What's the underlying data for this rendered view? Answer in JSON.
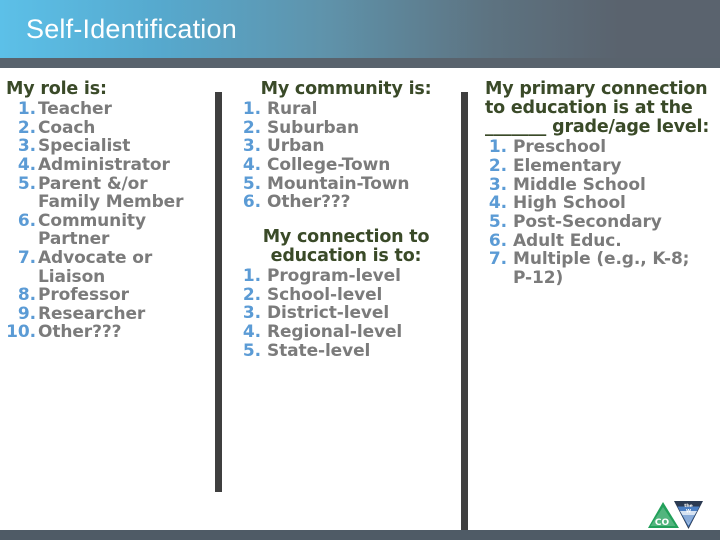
{
  "header": {
    "title": "Self-Identification",
    "gradient_start": "#5cc0e8",
    "gradient_end": "#5a636e",
    "title_color": "#ffffff"
  },
  "theme": {
    "heading_color": "#3a4a28",
    "number_color": "#5b9bd5",
    "item_color": "#7b7b7b",
    "divider_color": "#3f3f3f",
    "footer_color": "#4f5b66"
  },
  "columns": {
    "role": {
      "heading": "My role is:",
      "items": [
        {
          "num": "1.",
          "label": "Teacher"
        },
        {
          "num": "2.",
          "label": "Coach"
        },
        {
          "num": "3.",
          "label": "Specialist"
        },
        {
          "num": "4.",
          "label": "Administrator"
        },
        {
          "num": "5.",
          "label": "Parent &/or Family Member"
        },
        {
          "num": "6.",
          "label": "Community Partner"
        },
        {
          "num": "7.",
          "label": "Advocate or Liaison"
        },
        {
          "num": "8.",
          "label": "Professor"
        },
        {
          "num": "9.",
          "label": "Researcher"
        },
        {
          "num": "10.",
          "label": "Other???"
        }
      ]
    },
    "community": {
      "heading": "My community is:",
      "items": [
        {
          "num": "1.",
          "label": "Rural"
        },
        {
          "num": "2.",
          "label": "Suburban"
        },
        {
          "num": "3.",
          "label": "Urban"
        },
        {
          "num": "4.",
          "label": "College-Town"
        },
        {
          "num": "5.",
          "label": "Mountain-Town"
        },
        {
          "num": "6.",
          "label": "Other???"
        }
      ],
      "sub_heading": "My connection to education is to:",
      "sub_items": [
        {
          "num": "1.",
          "label": "Program-level"
        },
        {
          "num": "2.",
          "label": "School-level"
        },
        {
          "num": "3.",
          "label": "District-level"
        },
        {
          "num": "4.",
          "label": "Regional-level"
        },
        {
          "num": "5.",
          "label": "State-level"
        }
      ]
    },
    "grade": {
      "heading_line1": "My primary connection to education is at the",
      "heading_blank": "_______",
      "heading_line2": "grade/age level:",
      "items": [
        {
          "num": "1.",
          "label": "Preschool"
        },
        {
          "num": "2.",
          "label": "Elementary"
        },
        {
          "num": "3.",
          "label": "Middle School"
        },
        {
          "num": "4.",
          "label": "High School"
        },
        {
          "num": "5.",
          "label": "Post-Secondary"
        },
        {
          "num": "6.",
          "label": "Adult Educ."
        },
        {
          "num": "7.",
          "label": "Multiple (e.g., K-8; P-12)"
        }
      ]
    }
  },
  "logo": {
    "name": "co-state-logo",
    "primary_text": "CO",
    "triangle_green": "#22a05a",
    "triangle_navy": "#2b3a52",
    "triangle_blue": "#4b7fc4"
  }
}
